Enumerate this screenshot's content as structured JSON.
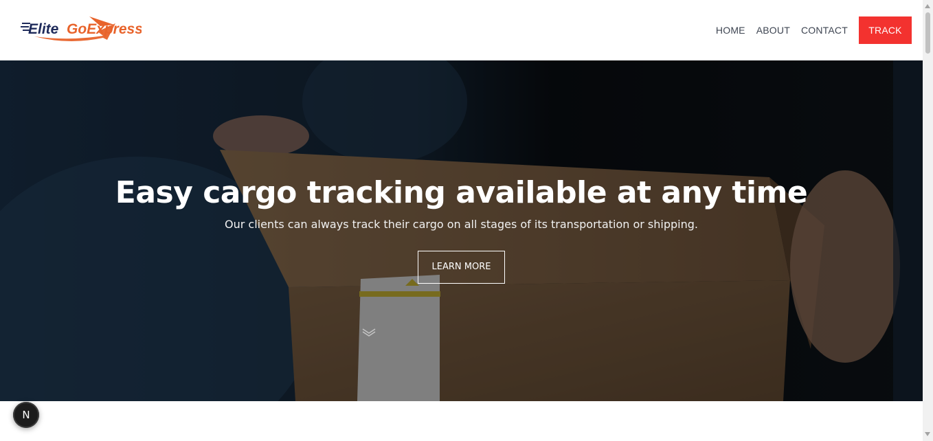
{
  "brand": {
    "logo_text_part1": "Elite",
    "logo_text_part2": "GoExpress",
    "primary_color": "#1e2a5a",
    "accent_color": "#e8632b"
  },
  "nav": {
    "items": [
      {
        "label": "HOME"
      },
      {
        "label": "ABOUT"
      },
      {
        "label": "CONTACT"
      }
    ],
    "cta_label": "TRACK",
    "cta_color": "#f3322f"
  },
  "hero": {
    "title": "Easy cargo tracking available at any time",
    "subtitle": "Our clients can always track their cargo on all stages of its transportation or shipping.",
    "button_label": "LEARN MORE",
    "scroll_icon": "chevron-down-icon"
  },
  "dev_indicator": {
    "label": "N"
  }
}
